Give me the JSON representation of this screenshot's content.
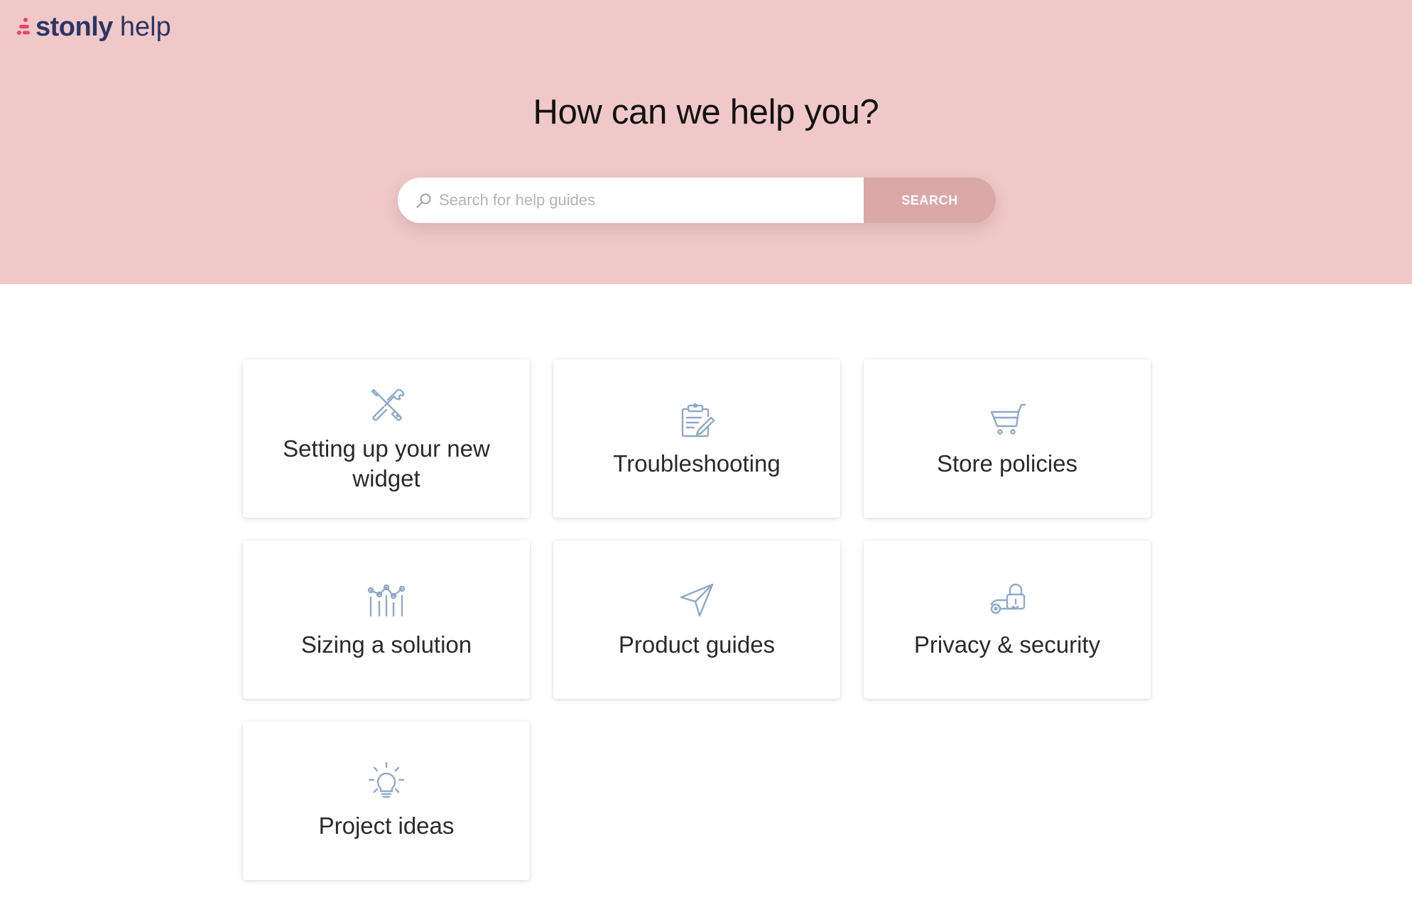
{
  "header": {
    "logo_word": "stonly",
    "logo_help": "help"
  },
  "hero": {
    "title": "How can we help you?",
    "search": {
      "placeholder": "Search for help guides",
      "value": "",
      "button_label": "SEARCH"
    }
  },
  "categories": [
    {
      "label": "Setting up your new widget",
      "icon": "tools-icon"
    },
    {
      "label": "Troubleshooting",
      "icon": "clipboard-edit-icon"
    },
    {
      "label": "Store policies",
      "icon": "shopping-cart-icon"
    },
    {
      "label": "Sizing a solution",
      "icon": "chart-sliders-icon"
    },
    {
      "label": "Product guides",
      "icon": "navigation-arrow-icon"
    },
    {
      "label": "Privacy & security",
      "icon": "lock-key-icon"
    },
    {
      "label": "Project ideas",
      "icon": "lightbulb-icon"
    }
  ],
  "colors": {
    "hero_background": "#f0c8c8",
    "search_button": "#dba8a8",
    "logo_text": "#2b3568",
    "logo_mark": "#e8456a",
    "icon_stroke": "#8fa9c9"
  }
}
